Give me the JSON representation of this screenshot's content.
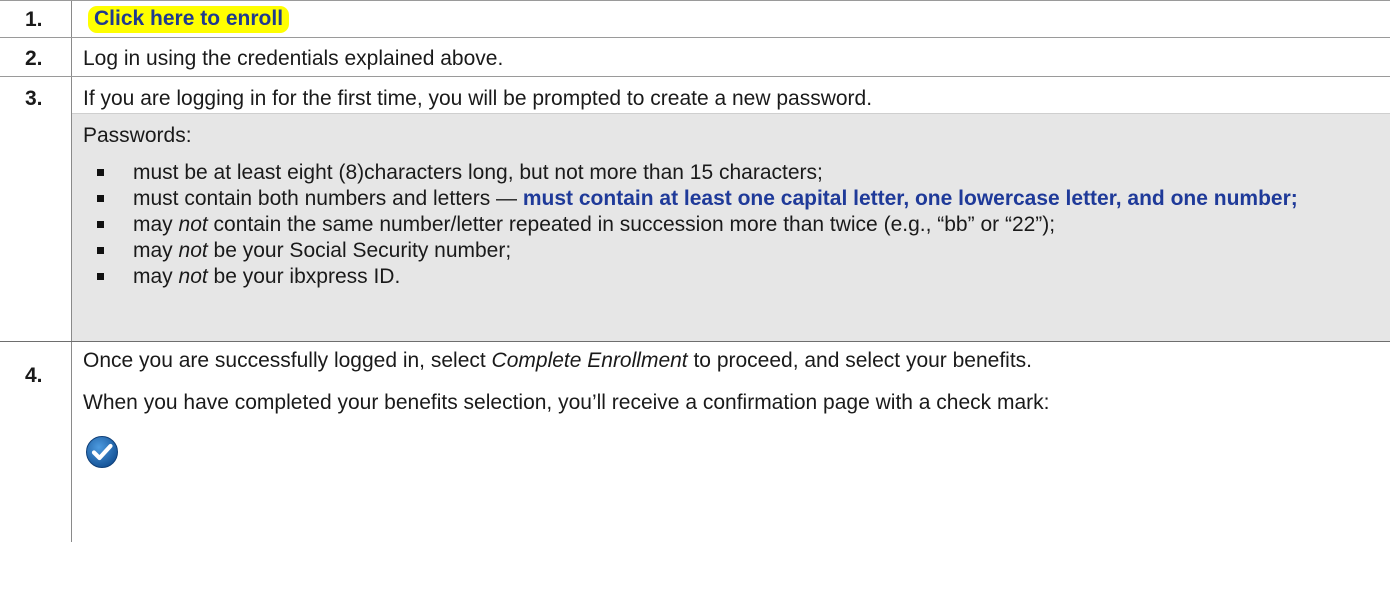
{
  "steps": [
    {
      "number": "1.",
      "link_label": "Click here to enroll"
    },
    {
      "number": "2.",
      "text": "Log in using the credentials explained above."
    },
    {
      "number": "3.",
      "text": "If you are logging in for the first time, you will be prompted to create a new password.",
      "rules_heading": "Passwords:",
      "rules": [
        {
          "pre": "must be at least eight (8)characters long, but not more than 15 characters;"
        },
        {
          "pre": "must contain both numbers and letters — ",
          "emphasis": "must contain at least one capital letter, one lowercase letter, and one number;"
        },
        {
          "pre": "may ",
          "italic": "not",
          "post": " contain the same number/letter repeated in succession more than twice (e.g., “bb” or “22”);"
        },
        {
          "pre": "may ",
          "italic": "not",
          "post": " be your Social Security number;"
        },
        {
          "pre": "may ",
          "italic": "not",
          "post": " be your ibxpress ID."
        }
      ]
    },
    {
      "number": "4.",
      "text_pre": "Once you are successfully logged in, select ",
      "text_italic": "Complete Enrollment",
      "text_post": " to proceed, and select your benefits.",
      "text2": "When you have completed your benefits selection, you’ll receive a confirmation page with a check mark:",
      "icon": "check-mark-icon",
      "icon_color": "#1b63a8"
    }
  ],
  "colors": {
    "highlight": "#ffff00",
    "link": "#1f3a8f",
    "emphasis": "#1f3a99",
    "gray_box": "#e6e6e6"
  }
}
